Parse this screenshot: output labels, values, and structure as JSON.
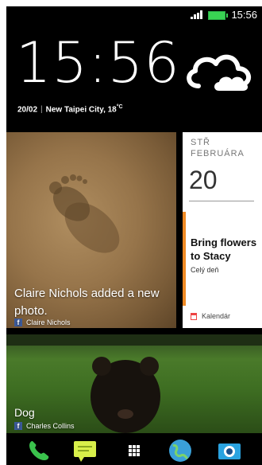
{
  "status_bar": {
    "time": "15:56"
  },
  "lock": {
    "clock": "15:56",
    "date": "20/02",
    "location": "New Taipei City, 18",
    "temp_unit": "°C"
  },
  "feed": [
    {
      "title": "Claire Nichols added a new photo.",
      "author": "Claire Nichols",
      "source": "facebook-icon"
    },
    {
      "title": "Dog",
      "author": "Charles Collins",
      "source": "facebook-icon"
    }
  ],
  "calendar": {
    "weekday": "STŘ",
    "month": "FEBRUÁRA",
    "day": "20",
    "event": "Bring flowers to Stacy",
    "event_time": "Celý deň",
    "app_label": "Kalendár",
    "accent_color": "#f08a24"
  },
  "dock": [
    "phone-icon",
    "messages-icon",
    "app-drawer-icon",
    "browser-icon",
    "camera-icon"
  ]
}
